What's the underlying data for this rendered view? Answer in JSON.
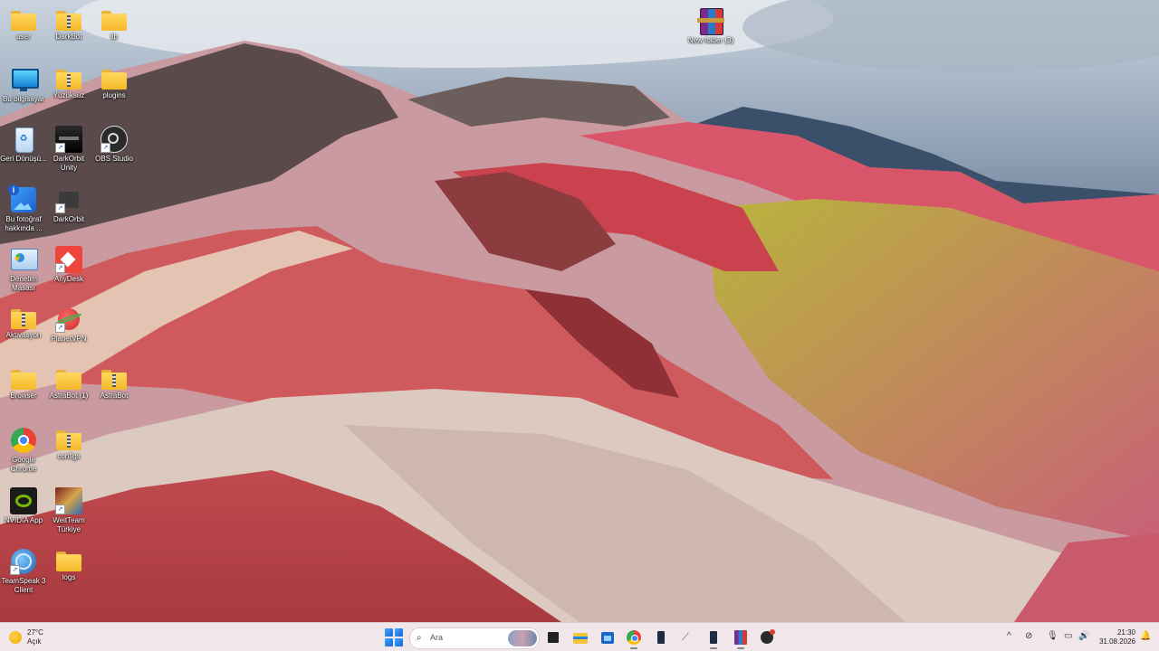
{
  "desktop": {
    "icons": [
      {
        "label": "user",
        "kind": "folder"
      },
      {
        "label": "DarkBot",
        "kind": "zipfolder"
      },
      {
        "label": "lib",
        "kind": "folder"
      },
      {
        "label": "Bu bilgisayar",
        "kind": "monitor"
      },
      {
        "label": "Yüzüksüz",
        "kind": "zipfolder"
      },
      {
        "label": "plugins",
        "kind": "folder"
      },
      {
        "label": "Geri Dönüşü...",
        "kind": "recycle-bin"
      },
      {
        "label": "DarkOrbit Unity",
        "kind": "app-dark"
      },
      {
        "label": "OBS Studio",
        "kind": "obs"
      },
      {
        "label": "Bu fotoğraf hakkında ...",
        "kind": "info"
      },
      {
        "label": "DarkOrbit",
        "kind": "app-dark"
      },
      {
        "label": "Denetim Masası",
        "kind": "control-panel"
      },
      {
        "label": "AnyDesk",
        "kind": "anydesk"
      },
      {
        "label": "Aktivasyon",
        "kind": "zipfolder"
      },
      {
        "label": "PlanetVPN",
        "kind": "vpn"
      },
      {
        "label": "Browser",
        "kind": "folder"
      },
      {
        "label": "AstraBot (1)",
        "kind": "folder"
      },
      {
        "label": "AstraBot",
        "kind": "zipfolder"
      },
      {
        "label": "Google Chrome",
        "kind": "chrome"
      },
      {
        "label": "configs",
        "kind": "zipfolder"
      },
      {
        "label": "NVIDIA App",
        "kind": "nvidia"
      },
      {
        "label": "WeitTeam Türkiye",
        "kind": "app-colorful"
      },
      {
        "label": "TeamSpeak 3 Client",
        "kind": "teamspeak"
      },
      {
        "label": "logs",
        "kind": "folder"
      },
      {
        "label": "New folder (3)",
        "kind": "winrar"
      }
    ]
  },
  "taskbar": {
    "weather": {
      "temperature": "27°C",
      "condition": "Açık"
    },
    "search_placeholder": "Ara",
    "apps": [
      "file-manager-icon",
      "file-explorer-icon",
      "store-icon",
      "chrome-icon",
      "app-icon",
      "network-icon",
      "app-icon-2",
      "winrar-icon",
      "darkbot-icon"
    ],
    "clock": {
      "time": "21:30",
      "date": "31.08.2026"
    }
  }
}
